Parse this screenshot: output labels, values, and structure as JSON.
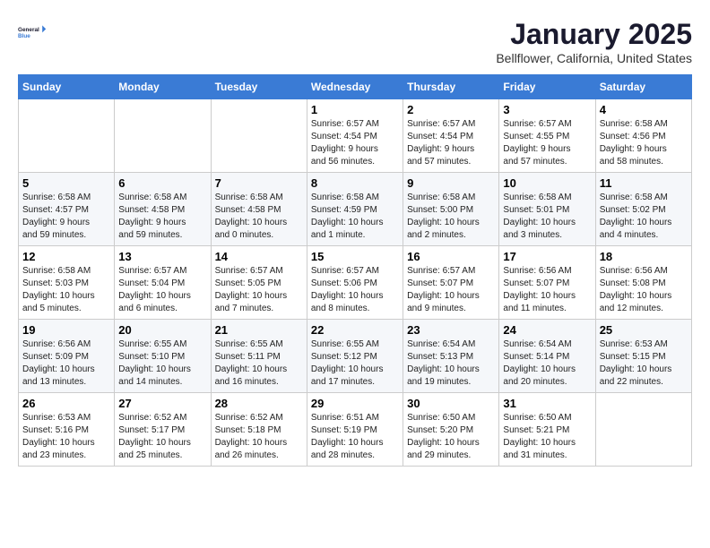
{
  "header": {
    "logo_line1": "General",
    "logo_line2": "Blue",
    "title": "January 2025",
    "subtitle": "Bellflower, California, United States"
  },
  "days_of_week": [
    "Sunday",
    "Monday",
    "Tuesday",
    "Wednesday",
    "Thursday",
    "Friday",
    "Saturday"
  ],
  "weeks": [
    [
      {
        "day": "",
        "info": ""
      },
      {
        "day": "",
        "info": ""
      },
      {
        "day": "",
        "info": ""
      },
      {
        "day": "1",
        "info": "Sunrise: 6:57 AM\nSunset: 4:54 PM\nDaylight: 9 hours\nand 56 minutes."
      },
      {
        "day": "2",
        "info": "Sunrise: 6:57 AM\nSunset: 4:54 PM\nDaylight: 9 hours\nand 57 minutes."
      },
      {
        "day": "3",
        "info": "Sunrise: 6:57 AM\nSunset: 4:55 PM\nDaylight: 9 hours\nand 57 minutes."
      },
      {
        "day": "4",
        "info": "Sunrise: 6:58 AM\nSunset: 4:56 PM\nDaylight: 9 hours\nand 58 minutes."
      }
    ],
    [
      {
        "day": "5",
        "info": "Sunrise: 6:58 AM\nSunset: 4:57 PM\nDaylight: 9 hours\nand 59 minutes."
      },
      {
        "day": "6",
        "info": "Sunrise: 6:58 AM\nSunset: 4:58 PM\nDaylight: 9 hours\nand 59 minutes."
      },
      {
        "day": "7",
        "info": "Sunrise: 6:58 AM\nSunset: 4:58 PM\nDaylight: 10 hours\nand 0 minutes."
      },
      {
        "day": "8",
        "info": "Sunrise: 6:58 AM\nSunset: 4:59 PM\nDaylight: 10 hours\nand 1 minute."
      },
      {
        "day": "9",
        "info": "Sunrise: 6:58 AM\nSunset: 5:00 PM\nDaylight: 10 hours\nand 2 minutes."
      },
      {
        "day": "10",
        "info": "Sunrise: 6:58 AM\nSunset: 5:01 PM\nDaylight: 10 hours\nand 3 minutes."
      },
      {
        "day": "11",
        "info": "Sunrise: 6:58 AM\nSunset: 5:02 PM\nDaylight: 10 hours\nand 4 minutes."
      }
    ],
    [
      {
        "day": "12",
        "info": "Sunrise: 6:58 AM\nSunset: 5:03 PM\nDaylight: 10 hours\nand 5 minutes."
      },
      {
        "day": "13",
        "info": "Sunrise: 6:57 AM\nSunset: 5:04 PM\nDaylight: 10 hours\nand 6 minutes."
      },
      {
        "day": "14",
        "info": "Sunrise: 6:57 AM\nSunset: 5:05 PM\nDaylight: 10 hours\nand 7 minutes."
      },
      {
        "day": "15",
        "info": "Sunrise: 6:57 AM\nSunset: 5:06 PM\nDaylight: 10 hours\nand 8 minutes."
      },
      {
        "day": "16",
        "info": "Sunrise: 6:57 AM\nSunset: 5:07 PM\nDaylight: 10 hours\nand 9 minutes."
      },
      {
        "day": "17",
        "info": "Sunrise: 6:56 AM\nSunset: 5:07 PM\nDaylight: 10 hours\nand 11 minutes."
      },
      {
        "day": "18",
        "info": "Sunrise: 6:56 AM\nSunset: 5:08 PM\nDaylight: 10 hours\nand 12 minutes."
      }
    ],
    [
      {
        "day": "19",
        "info": "Sunrise: 6:56 AM\nSunset: 5:09 PM\nDaylight: 10 hours\nand 13 minutes."
      },
      {
        "day": "20",
        "info": "Sunrise: 6:55 AM\nSunset: 5:10 PM\nDaylight: 10 hours\nand 14 minutes."
      },
      {
        "day": "21",
        "info": "Sunrise: 6:55 AM\nSunset: 5:11 PM\nDaylight: 10 hours\nand 16 minutes."
      },
      {
        "day": "22",
        "info": "Sunrise: 6:55 AM\nSunset: 5:12 PM\nDaylight: 10 hours\nand 17 minutes."
      },
      {
        "day": "23",
        "info": "Sunrise: 6:54 AM\nSunset: 5:13 PM\nDaylight: 10 hours\nand 19 minutes."
      },
      {
        "day": "24",
        "info": "Sunrise: 6:54 AM\nSunset: 5:14 PM\nDaylight: 10 hours\nand 20 minutes."
      },
      {
        "day": "25",
        "info": "Sunrise: 6:53 AM\nSunset: 5:15 PM\nDaylight: 10 hours\nand 22 minutes."
      }
    ],
    [
      {
        "day": "26",
        "info": "Sunrise: 6:53 AM\nSunset: 5:16 PM\nDaylight: 10 hours\nand 23 minutes."
      },
      {
        "day": "27",
        "info": "Sunrise: 6:52 AM\nSunset: 5:17 PM\nDaylight: 10 hours\nand 25 minutes."
      },
      {
        "day": "28",
        "info": "Sunrise: 6:52 AM\nSunset: 5:18 PM\nDaylight: 10 hours\nand 26 minutes."
      },
      {
        "day": "29",
        "info": "Sunrise: 6:51 AM\nSunset: 5:19 PM\nDaylight: 10 hours\nand 28 minutes."
      },
      {
        "day": "30",
        "info": "Sunrise: 6:50 AM\nSunset: 5:20 PM\nDaylight: 10 hours\nand 29 minutes."
      },
      {
        "day": "31",
        "info": "Sunrise: 6:50 AM\nSunset: 5:21 PM\nDaylight: 10 hours\nand 31 minutes."
      },
      {
        "day": "",
        "info": ""
      }
    ]
  ]
}
